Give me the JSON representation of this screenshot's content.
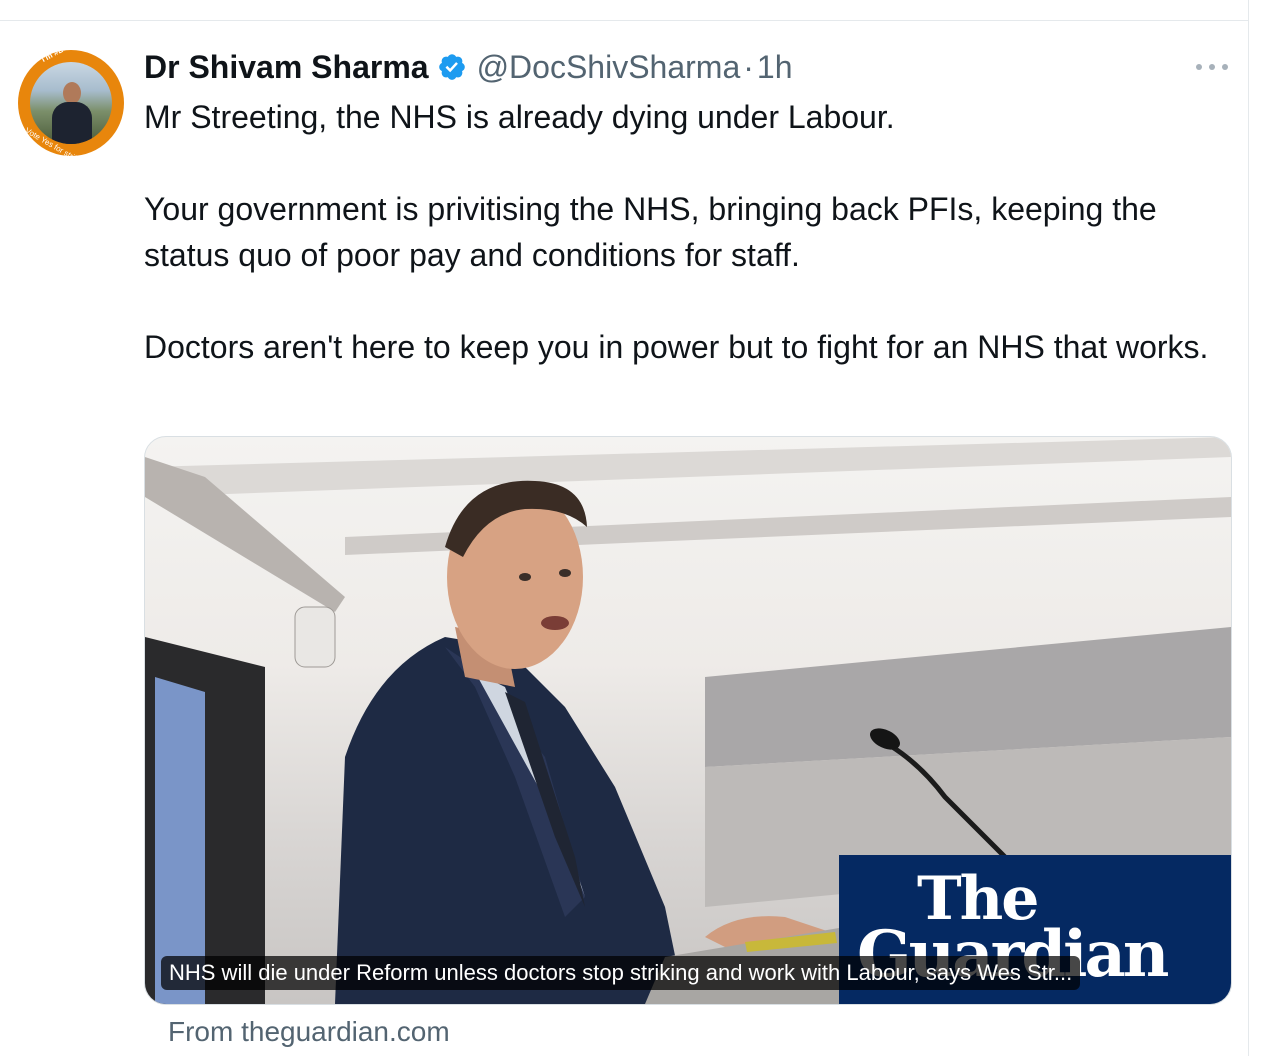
{
  "tweet": {
    "author_name": "Dr Shivam Sharma",
    "handle": "@DocShivSharma",
    "separator": "·",
    "time": "1h",
    "avatar_text_top": "I'm #BMABallotReady",
    "avatar_text_bottom": "Vote Yes for strike action",
    "paragraphs": [
      "Mr Streeting, the NHS is already dying under Labour.",
      "Your government is privitising the NHS, bringing back PFIs, keeping the status quo of poor pay and conditions for staff.",
      "Doctors aren't here to keep you in power but to fight for an NHS that works."
    ]
  },
  "link_card": {
    "headline": "NHS will die under Reform unless doctors stop striking and work with Labour, says Wes Str...",
    "logo_line1": "The",
    "logo_line2": "Guardian",
    "source": "From theguardian.com"
  },
  "icons": {
    "verified": "verified-badge-icon",
    "more": "more-options-icon"
  },
  "colors": {
    "verified_blue": "#1d9bf0",
    "secondary_text": "#536471",
    "guardian_blue": "#052962",
    "avatar_ring": "#e8860c"
  }
}
